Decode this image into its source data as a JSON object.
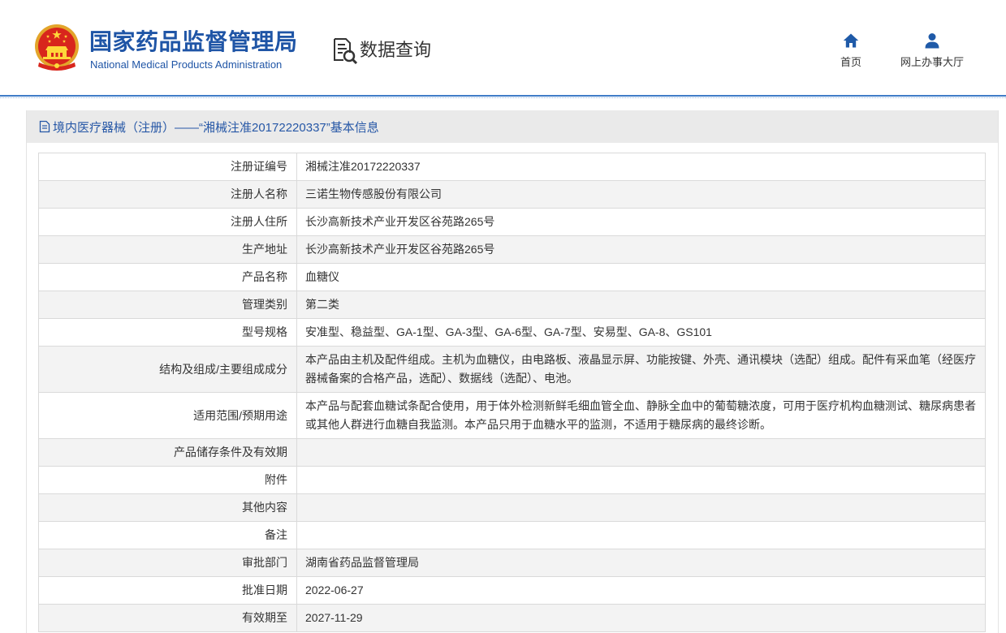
{
  "header": {
    "emblem": "national-emblem-icon",
    "title_cn": "国家药品监督管理局",
    "title_en": "National Medical Products Administration",
    "section_icon": "document-search-icon",
    "section_label": "数据查询",
    "nav": [
      {
        "label": "首页",
        "icon": "home-icon"
      },
      {
        "label": "网上办事大厅",
        "icon": "user-icon"
      }
    ]
  },
  "panel": {
    "icon": "document-icon",
    "title": "境内医疗器械（注册）——“湘械注准20172220337”基本信息"
  },
  "rows": [
    {
      "label": "注册证编号",
      "value": "湘械注准20172220337"
    },
    {
      "label": "注册人名称",
      "value": "三诺生物传感股份有限公司"
    },
    {
      "label": "注册人住所",
      "value": "长沙高新技术产业开发区谷苑路265号"
    },
    {
      "label": "生产地址",
      "value": "长沙高新技术产业开发区谷苑路265号"
    },
    {
      "label": "产品名称",
      "value": "血糖仪"
    },
    {
      "label": "管理类别",
      "value": "第二类"
    },
    {
      "label": "型号规格",
      "value": "安准型、稳益型、GA-1型、GA-3型、GA-6型、GA-7型、安易型、GA-8、GS101"
    },
    {
      "label": "结构及组成/主要组成成分",
      "value": "本产品由主机及配件组成。主机为血糖仪，由电路板、液晶显示屏、功能按键、外壳、通讯模块（选配）组成。配件有采血笔（经医疗器械备案的合格产品，选配）、数据线（选配）、电池。"
    },
    {
      "label": "适用范围/预期用途",
      "value": "本产品与配套血糖试条配合使用，用于体外检测新鲜毛细血管全血、静脉全血中的葡萄糖浓度，可用于医疗机构血糖测试、糖尿病患者或其他人群进行血糖自我监测。本产品只用于血糖水平的监测，不适用于糖尿病的最终诊断。"
    },
    {
      "label": "产品储存条件及有效期",
      "value": ""
    },
    {
      "label": "附件",
      "value": ""
    },
    {
      "label": "其他内容",
      "value": ""
    },
    {
      "label": "备注",
      "value": ""
    },
    {
      "label": "审批部门",
      "value": "湖南省药品监督管理局"
    },
    {
      "label": "批准日期",
      "value": "2022-06-27"
    },
    {
      "label": "有效期至",
      "value": "2027-11-29"
    }
  ],
  "colors": {
    "brand_blue": "#1f55a6",
    "title_text_blue": "#2657a6",
    "title_bar_bg": "#eaeaea",
    "row_alt_bg": "#f3f3f3",
    "border": "#dadada",
    "text": "#333333",
    "icon_blue": "#1f5aa8"
  }
}
